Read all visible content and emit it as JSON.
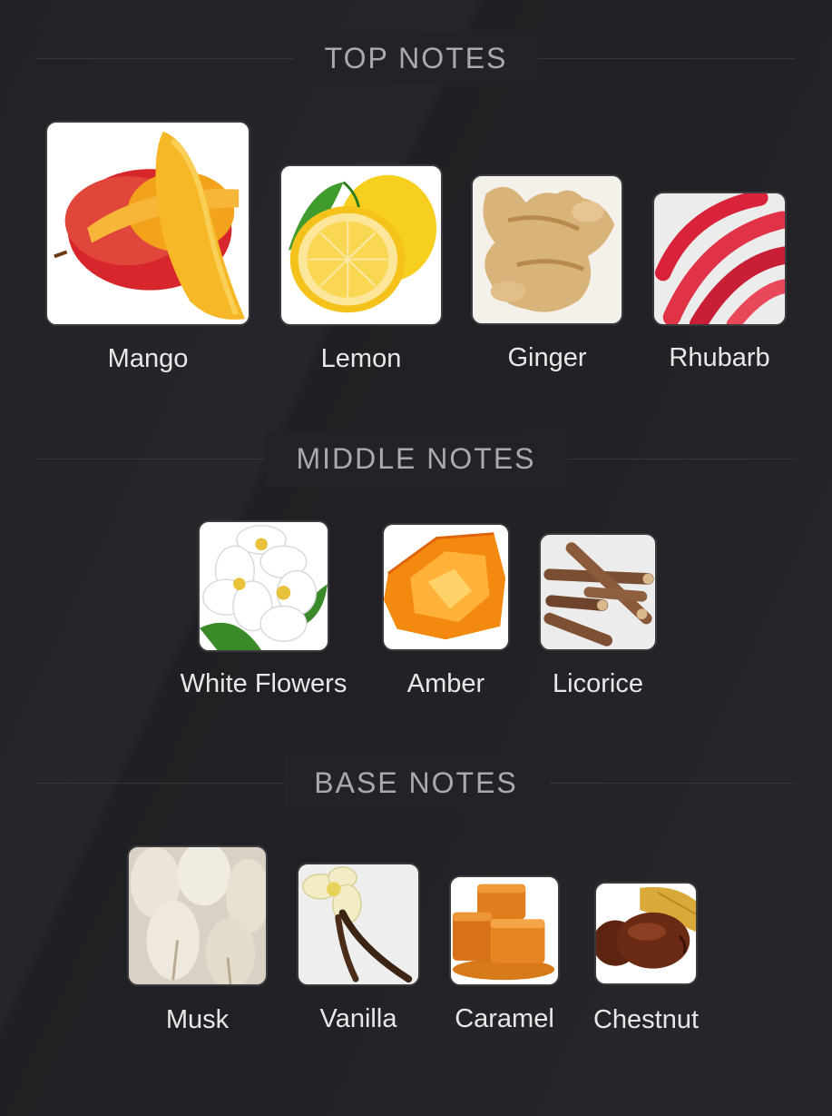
{
  "top_notes": {
    "title": "TOP NOTES",
    "items": [
      {
        "label": "Mango",
        "icon": "mango-icon"
      },
      {
        "label": "Lemon",
        "icon": "lemon-icon"
      },
      {
        "label": "Ginger",
        "icon": "ginger-icon"
      },
      {
        "label": "Rhubarb",
        "icon": "rhubarb-icon"
      }
    ]
  },
  "middle_notes": {
    "title": "MIDDLE NOTES",
    "items": [
      {
        "label": "White Flowers",
        "icon": "white-flowers-icon"
      },
      {
        "label": "Amber",
        "icon": "amber-icon"
      },
      {
        "label": "Licorice",
        "icon": "licorice-icon"
      }
    ]
  },
  "base_notes": {
    "title": "BASE NOTES",
    "items": [
      {
        "label": "Musk",
        "icon": "musk-icon"
      },
      {
        "label": "Vanilla",
        "icon": "vanilla-icon"
      },
      {
        "label": "Caramel",
        "icon": "caramel-icon"
      },
      {
        "label": "Chestnut",
        "icon": "chestnut-icon"
      }
    ]
  },
  "colors": {
    "background": "#222226",
    "header_text": "#a9aab0",
    "label_text": "#e8e8ea"
  }
}
